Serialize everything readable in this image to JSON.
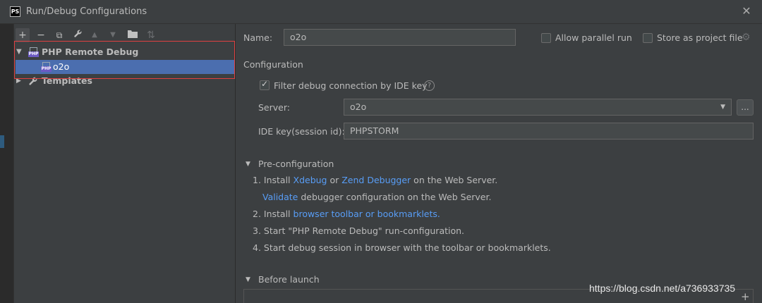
{
  "window": {
    "title": "Run/Debug Configurations",
    "logo": "PS"
  },
  "toolbar": {
    "icons": [
      "add-icon",
      "remove-icon",
      "copy-icon",
      "wrench-icon",
      "move-up-icon",
      "move-down-icon",
      "folder-icon",
      "sort-icon"
    ],
    "add": "+",
    "remove": "−",
    "copy": "⧉",
    "wrench": "🔧",
    "up": "▲",
    "down": "▼",
    "folder": "▣",
    "sort": "⇅"
  },
  "tree": {
    "group_label": "PHP Remote Debug",
    "item_label": "o2o",
    "templates_label": "Templates",
    "expanded_arrow": "▼",
    "collapsed_arrow": "▶",
    "icon_badge": "PHP"
  },
  "form": {
    "name_label": "Name:",
    "name_value": "o2o",
    "allow_parallel": "Allow parallel run",
    "store_project": "Store as project file",
    "configuration": "Configuration",
    "filter_label": "Filter debug connection by IDE key",
    "help": "?",
    "server_label": "Server:",
    "server_value": "o2o",
    "dots": "...",
    "ide_key_label": "IDE key(session id):",
    "ide_key_value": "PHPSTORM"
  },
  "preconfig": {
    "title": "Pre-configuration",
    "step1_prefix": "1. Install ",
    "step1_link1": "Xdebug",
    "step1_mid": " or ",
    "step1_link2": "Zend Debugger",
    "step1_suffix": " on the Web Server.",
    "step1b_link": "Validate",
    "step1b_suffix": " debugger configuration on the Web Server.",
    "step2_prefix": "2. Install ",
    "step2_link": "browser toolbar or bookmarklets.",
    "step3": "3. Start \"PHP Remote Debug\" run-configuration.",
    "step4": "4. Start debug session in browser with the toolbar or bookmarklets."
  },
  "before_launch": {
    "title": "Before launch",
    "plus": "+"
  },
  "watermark": "https://blog.csdn.net/a736933735",
  "colors": {
    "accent": "#4b6eaf",
    "link": "#589df6",
    "highlight": "#e04141",
    "php_badge": "#6c5bc4"
  }
}
